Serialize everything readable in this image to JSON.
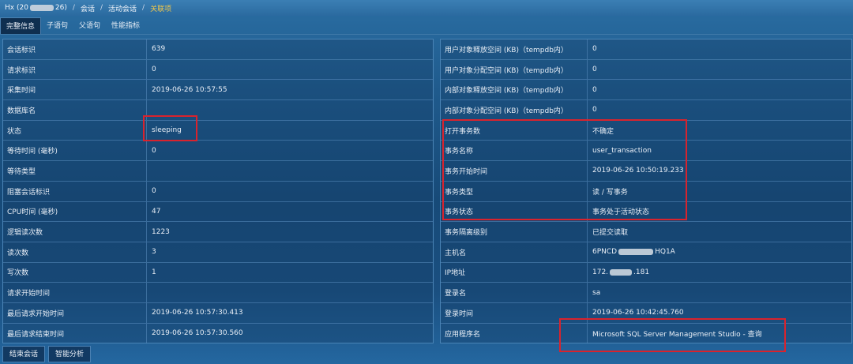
{
  "breadcrumb": {
    "host": "Hx (20",
    "host_suffix": "26)",
    "items": [
      "会话",
      "活动会话",
      "关联项"
    ]
  },
  "tabs": [
    "完整信息",
    "子语句",
    "父语句",
    "性能指标"
  ],
  "left_rows": [
    {
      "label": "会话标识",
      "value": "639"
    },
    {
      "label": "请求标识",
      "value": "0"
    },
    {
      "label": "采集时间",
      "value": "2019-06-26 10:57:55"
    },
    {
      "label": "数据库名",
      "value": ""
    },
    {
      "label": "状态",
      "value": "sleeping"
    },
    {
      "label": "等待时间 (毫秒)",
      "value": "0"
    },
    {
      "label": "等待类型",
      "value": ""
    },
    {
      "label": "阻塞会话标识",
      "value": "0"
    },
    {
      "label": "CPU时间 (毫秒)",
      "value": "47"
    },
    {
      "label": "逻辑读次数",
      "value": "1223"
    },
    {
      "label": "读次数",
      "value": "3"
    },
    {
      "label": "写次数",
      "value": "1"
    },
    {
      "label": "请求开始时间",
      "value": ""
    },
    {
      "label": "最后请求开始时间",
      "value": "2019-06-26 10:57:30.413"
    },
    {
      "label": "最后请求结束时间",
      "value": "2019-06-26 10:57:30.560"
    }
  ],
  "right_rows": [
    {
      "label": "用户对象释放空间 (KB)（tempdb内）",
      "value": "0"
    },
    {
      "label": "用户对象分配空间 (KB)（tempdb内）",
      "value": "0"
    },
    {
      "label": "内部对象释放空间 (KB)（tempdb内）",
      "value": "0"
    },
    {
      "label": "内部对象分配空间 (KB)（tempdb内）",
      "value": "0"
    },
    {
      "label": "打开事务数",
      "value": "不确定"
    },
    {
      "label": "事务名称",
      "value": "user_transaction"
    },
    {
      "label": "事务开始时间",
      "value": "2019-06-26 10:50:19.233"
    },
    {
      "label": "事务类型",
      "value": "读 / 写事务"
    },
    {
      "label": "事务状态",
      "value": "事务处于活动状态"
    },
    {
      "label": "事务隔离级别",
      "value": "已提交读取"
    },
    {
      "label": "主机名",
      "value": "6PNCD",
      "value_suffix": "HQ1A"
    },
    {
      "label": "IP地址",
      "value": "172.",
      "value_suffix": ".181"
    },
    {
      "label": "登录名",
      "value": "sa"
    },
    {
      "label": "登录时间",
      "value": "2019-06-26 10:42:45.760"
    },
    {
      "label": "应用程序名",
      "value": "Microsoft SQL Server Management Studio - 查询"
    }
  ],
  "buttons": {
    "end_session": "结束会话",
    "smart_analysis": "智能分析"
  },
  "colors": {
    "highlight": "#d9232d",
    "active_crumb": "#f2c84a"
  }
}
